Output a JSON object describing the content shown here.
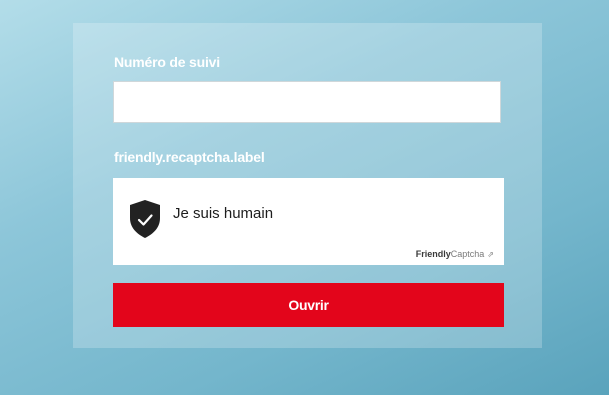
{
  "form": {
    "tracking_label": "Numéro de suivi",
    "tracking_value": "",
    "captcha_label": "friendly.recaptcha.label",
    "captcha_text": "Je suis humain",
    "captcha_brand_strong": "Friendly",
    "captcha_brand_light": "Captcha",
    "captcha_brand_icon": "external-link-icon",
    "submit_label": "Ouvrir"
  },
  "colors": {
    "accent": "#e3051b",
    "background": "#8dc6d9",
    "shield": "#222222"
  }
}
